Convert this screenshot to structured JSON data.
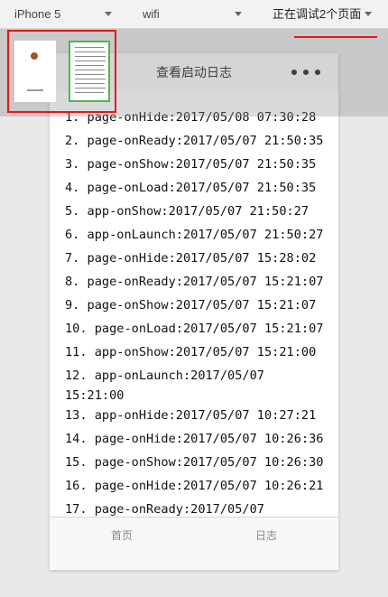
{
  "toolbar": {
    "device": "iPhone 5",
    "network": "wifi",
    "pages": "正在调试2个页面"
  },
  "nav": {
    "title": "查看启动日志",
    "more_icon": "more-dots-icon"
  },
  "logs": [
    "1. page-onHide:2017/05/08 07:30:28",
    "2. page-onReady:2017/05/07 21:50:35",
    "3. page-onShow:2017/05/07 21:50:35",
    "4. page-onLoad:2017/05/07 21:50:35",
    "5. app-onShow:2017/05/07 21:50:27",
    "6. app-onLaunch:2017/05/07 21:50:27",
    "7. page-onHide:2017/05/07 15:28:02",
    "8. page-onReady:2017/05/07 15:21:07",
    "9. page-onShow:2017/05/07 15:21:07",
    "10. page-onLoad:2017/05/07 15:21:07",
    "11. app-onShow:2017/05/07 15:21:00",
    "12. app-onLaunch:2017/05/07 15:21:00",
    "13. app-onHide:2017/05/07 10:27:21",
    "14. page-onHide:2017/05/07 10:26:36",
    "15. page-onShow:2017/05/07 10:26:30",
    "16. page-onHide:2017/05/07 10:26:21",
    "17. page-onReady:2017/05/07"
  ],
  "tabs": {
    "home": "首页",
    "log": "日志"
  },
  "colors": {
    "highlight_red": "#e8131b",
    "active_green": "#4cb84c"
  }
}
